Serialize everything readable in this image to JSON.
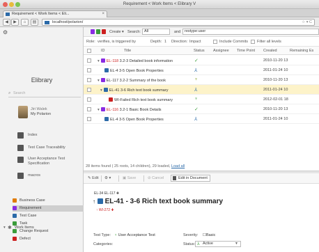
{
  "window": {
    "title": "Requirement < Work Items < Elibrary V"
  },
  "tab": {
    "title": "Requirement < Work Items < Eli...",
    "close": "×"
  },
  "nav": {
    "back": "◀",
    "forward": "▶",
    "home": "⌂",
    "url": "localhost/polarion/",
    "url_right": "☆ ▾ C"
  },
  "sidebar": {
    "app_title": "Elibrary",
    "search_placeholder": "Search",
    "user": {
      "name": "Jiri Walek",
      "project": "My Polarion"
    },
    "nav_items": [
      {
        "label": "Index"
      },
      {
        "label": "Test Case Traceability"
      },
      {
        "label": "User Acceptance Test Specification"
      },
      {
        "label": "macros"
      }
    ],
    "work_items": {
      "header": "Work Items",
      "items": [
        {
          "label": "Business Case",
          "color": "#e07b00"
        },
        {
          "label": "Requirement",
          "color": "#8a2be2"
        },
        {
          "label": "Test Case",
          "color": "#2b6aa8"
        },
        {
          "label": "Task",
          "color": "#3a9c3a"
        },
        {
          "label": "Change Request",
          "color": "#3a9c3a"
        },
        {
          "label": "Defect",
          "color": "#cc1f1f"
        }
      ]
    }
  },
  "toolbar": {
    "create": "Create ▾",
    "search_label": "Search:",
    "search_scope": "All",
    "and_label": "and",
    "query": "restype:user"
  },
  "querybar": {
    "role_label": "Role:",
    "role": "verifies, is triggered by",
    "depth_label": "Depth:",
    "depth": "1",
    "direction_label": "Direction:",
    "direction": "Impact",
    "include_commits": "Include Commits",
    "filter_all_levels": "Filter all levels"
  },
  "table": {
    "headers": [
      "ID",
      "Title",
      "Status",
      "Assignee",
      "Time Point",
      "Created",
      "Remaining Es"
    ],
    "rows": [
      {
        "id": "EL-118",
        "title": "3.2-3 Detailed book information",
        "created": "2010-11-20 13",
        "indent": 0,
        "status": "✓",
        "highlight": false,
        "red": true
      },
      {
        "id": "EL-4",
        "title": "3-5 Open Book Properties",
        "created": "2011-01-24 10",
        "indent": 1,
        "status": "⅄",
        "highlight": false,
        "red": false
      },
      {
        "id": "EL-117",
        "title": "3.2-2 Summary of the book",
        "created": "2010-11-20 13",
        "indent": 0,
        "status": "♆",
        "highlight": false,
        "red": false
      },
      {
        "id": "EL-41",
        "title": "3-6 Rich text book summary",
        "created": "2011-01-24 10",
        "indent": 1,
        "status": "⅄",
        "highlight": true,
        "red": false
      },
      {
        "id": "WI-Failed",
        "title": "Rich text book summary",
        "created": "2012-02-01 18",
        "indent": 2,
        "status": "♆",
        "highlight": false,
        "red": true
      },
      {
        "id": "EL-116",
        "title": "3.2-1 Basic Book Details",
        "created": "2010-11-20 13",
        "indent": 0,
        "status": "✓",
        "highlight": false,
        "red": true
      },
      {
        "id": "EL-4",
        "title": "3-5 Open Book Properties",
        "created": "2011-01-24 10",
        "indent": 1,
        "status": "⅄",
        "highlight": false,
        "red": false
      }
    ],
    "footer": "28 items found ( 25 roots, 14 children), 29 loaded,",
    "footer_link": "Load all"
  },
  "detail": {
    "toolbar": {
      "edit": "Edit",
      "gear": "⚙ ▾",
      "save": "Save",
      "cancel": "Cancel",
      "doc": "Edit in Document"
    },
    "breadcrumb": "EL-34  EL-117 ✚",
    "title": "EL-41 - 3-6 Rich text book summary",
    "sub": "WI-272 ✚",
    "fields": {
      "test_type_label": "Test Type:",
      "test_type": "User Acceptance Test",
      "severity_label": "Severity:",
      "severity": "Basic",
      "categories_label": "Categories:",
      "status_label": "Status:",
      "status": "Active"
    }
  }
}
